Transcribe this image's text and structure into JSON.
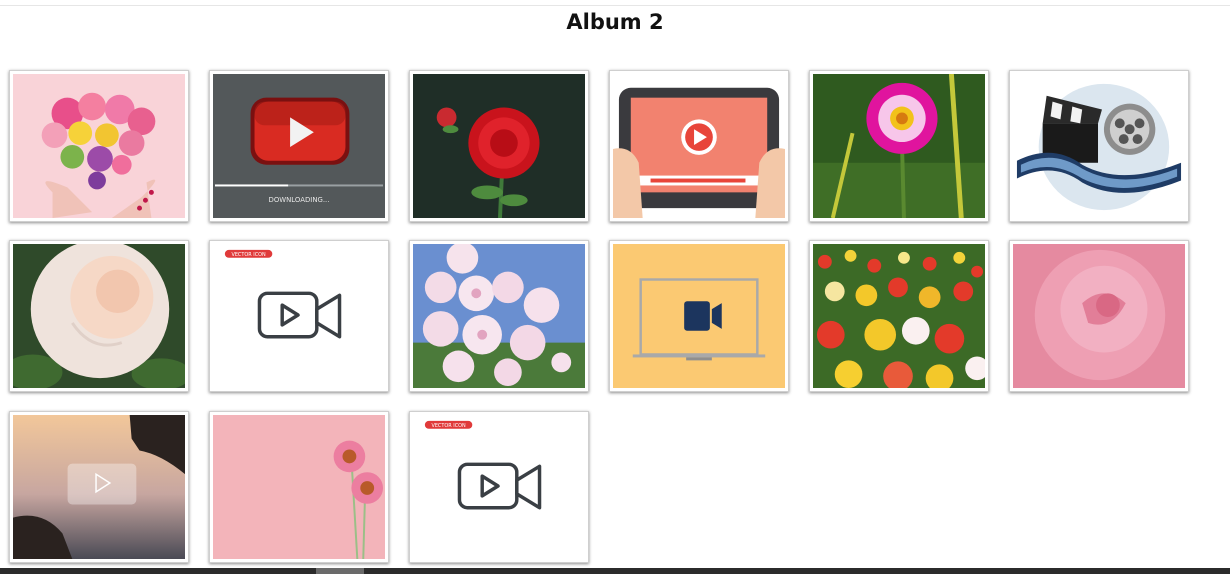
{
  "album": {
    "title": "Album 2"
  },
  "thumbnails": [
    {
      "icon": "heart-flowers-image"
    },
    {
      "icon": "video-downloading-image",
      "caption": "DOWNLOADING..."
    },
    {
      "icon": "red-dahlia-image"
    },
    {
      "icon": "tablet-video-player-image"
    },
    {
      "icon": "pink-dahlia-image"
    },
    {
      "icon": "clapperboard-film-reel-image"
    },
    {
      "icon": "white-rose-image"
    },
    {
      "icon": "video-camera-vector-icon-image",
      "badge": "VECTOR ICON"
    },
    {
      "icon": "white-daisies-image"
    },
    {
      "icon": "laptop-video-call-image"
    },
    {
      "icon": "tulip-field-image"
    },
    {
      "icon": "pink-rose-image"
    },
    {
      "icon": "hands-framing-video-image"
    },
    {
      "icon": "pink-gerbera-image"
    },
    {
      "icon": "video-camera-vector-icon-image",
      "badge": "VECTOR ICON"
    }
  ]
}
